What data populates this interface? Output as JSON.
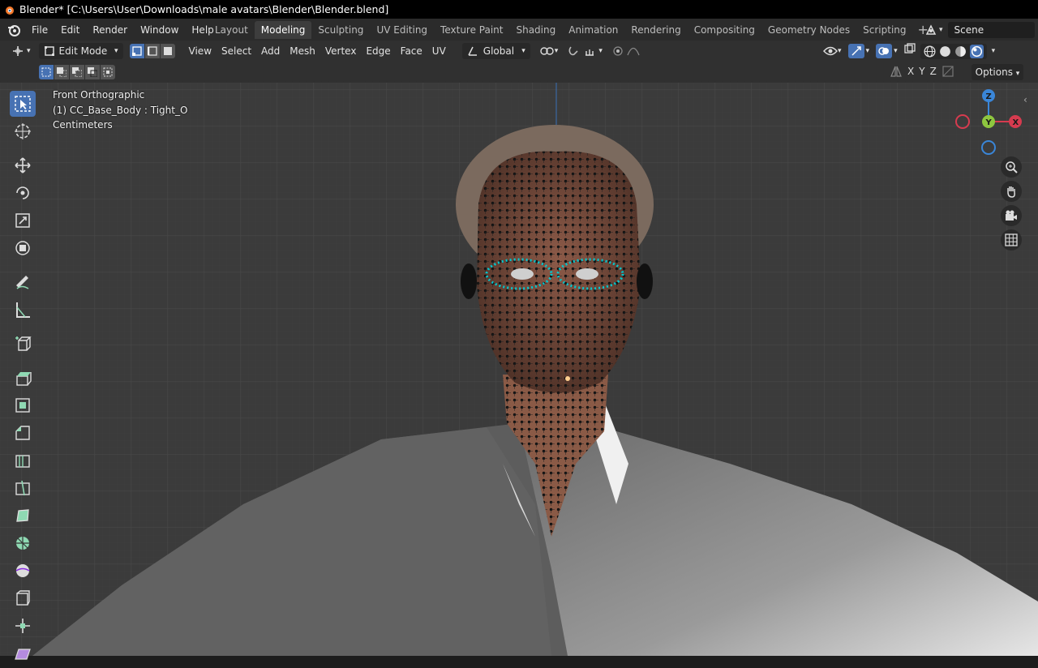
{
  "window": {
    "title": "Blender* [C:\\Users\\User\\Downloads\\male avatars\\Blender\\Blender.blend]"
  },
  "menu": [
    "File",
    "Edit",
    "Render",
    "Window",
    "Help"
  ],
  "workspaces": [
    "Layout",
    "Modeling",
    "Sculpting",
    "UV Editing",
    "Texture Paint",
    "Shading",
    "Animation",
    "Rendering",
    "Compositing",
    "Geometry Nodes",
    "Scripting"
  ],
  "active_workspace": "Modeling",
  "scene": {
    "label": "Scene"
  },
  "header": {
    "mode": "Edit Mode",
    "menus": [
      "View",
      "Select",
      "Add",
      "Mesh",
      "Vertex",
      "Edge",
      "Face",
      "UV"
    ],
    "transform_orientation": "Global"
  },
  "subbar": {
    "axes": [
      "X",
      "Y",
      "Z"
    ],
    "options": "Options"
  },
  "viewport": {
    "view_name": "Front Orthographic",
    "object_info": "(1) CC_Base_Body : Tight_O",
    "units": "Centimeters"
  },
  "gizmo": {
    "z": "Z",
    "y": "Y",
    "x": "X"
  },
  "colors": {
    "accent": "#4772b3",
    "x_axis": "#d63b4f",
    "y_axis": "#8ec63f",
    "z_axis": "#3a86d8"
  }
}
